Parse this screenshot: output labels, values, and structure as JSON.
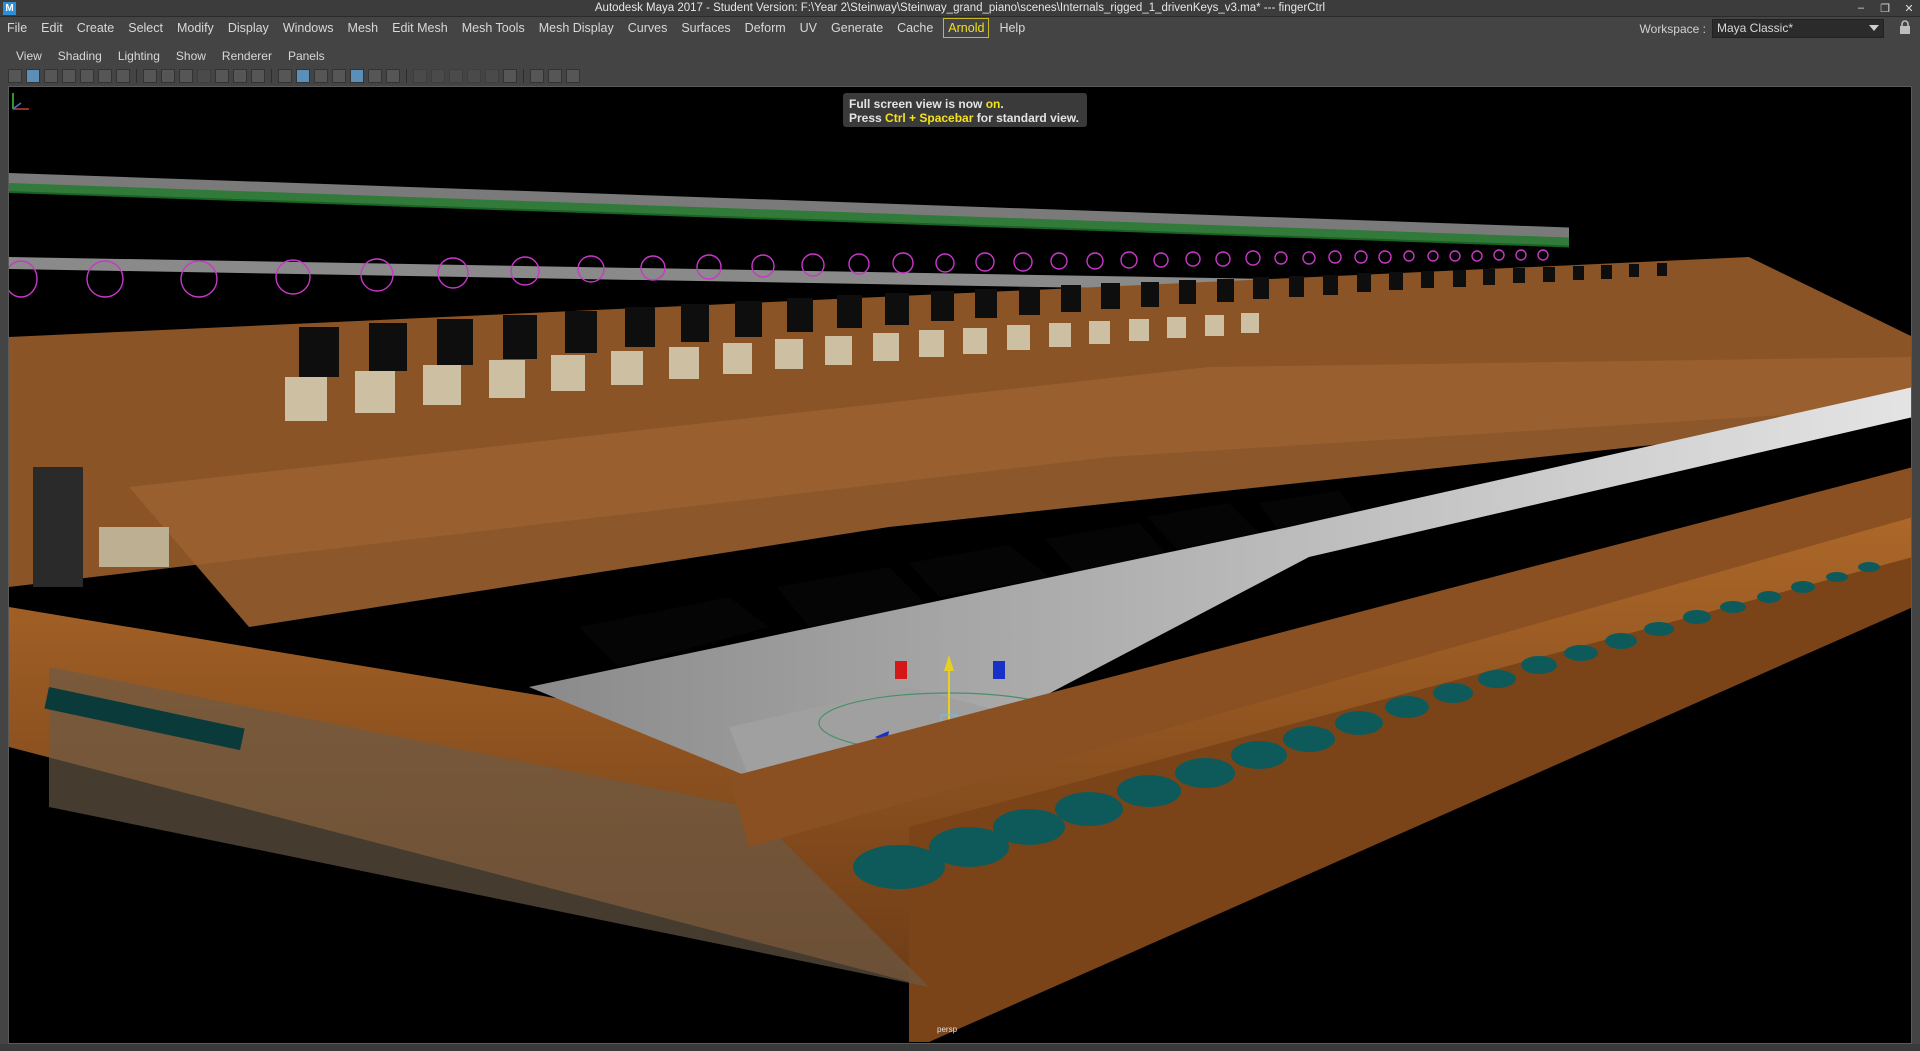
{
  "window": {
    "title": "Autodesk Maya 2017 - Student Version: F:\\Year 2\\Steinway\\Steinway_grand_piano\\scenes\\Internals_rigged_1_drivenKeys_v3.ma*  ---  fingerCtrl",
    "app_icon": "M"
  },
  "menubar": {
    "items": [
      "File",
      "Edit",
      "Create",
      "Select",
      "Modify",
      "Display",
      "Windows",
      "Mesh",
      "Edit Mesh",
      "Mesh Tools",
      "Mesh Display",
      "Curves",
      "Surfaces",
      "Deform",
      "UV",
      "Generate",
      "Cache",
      "Arnold",
      "Help"
    ],
    "highlighted": "Arnold"
  },
  "workspace": {
    "label": "Workspace :",
    "value": "Maya Classic*"
  },
  "panel_menu": {
    "items": [
      "View",
      "Shading",
      "Lighting",
      "Show",
      "Renderer",
      "Panels"
    ]
  },
  "hud": {
    "line1_prefix": "Full screen view is now ",
    "line1_highlight": "on",
    "line1_suffix": ".",
    "line2_prefix": "Press ",
    "line2_highlight": "Ctrl + Spacebar",
    "line2_suffix": " for standard view."
  },
  "viewport": {
    "camera_label": "persp"
  },
  "colors": {
    "accent": "#f4e21c",
    "wood": "#9a5a24",
    "control_curve": "#c838c8",
    "key_white": "#bdbdbd"
  }
}
